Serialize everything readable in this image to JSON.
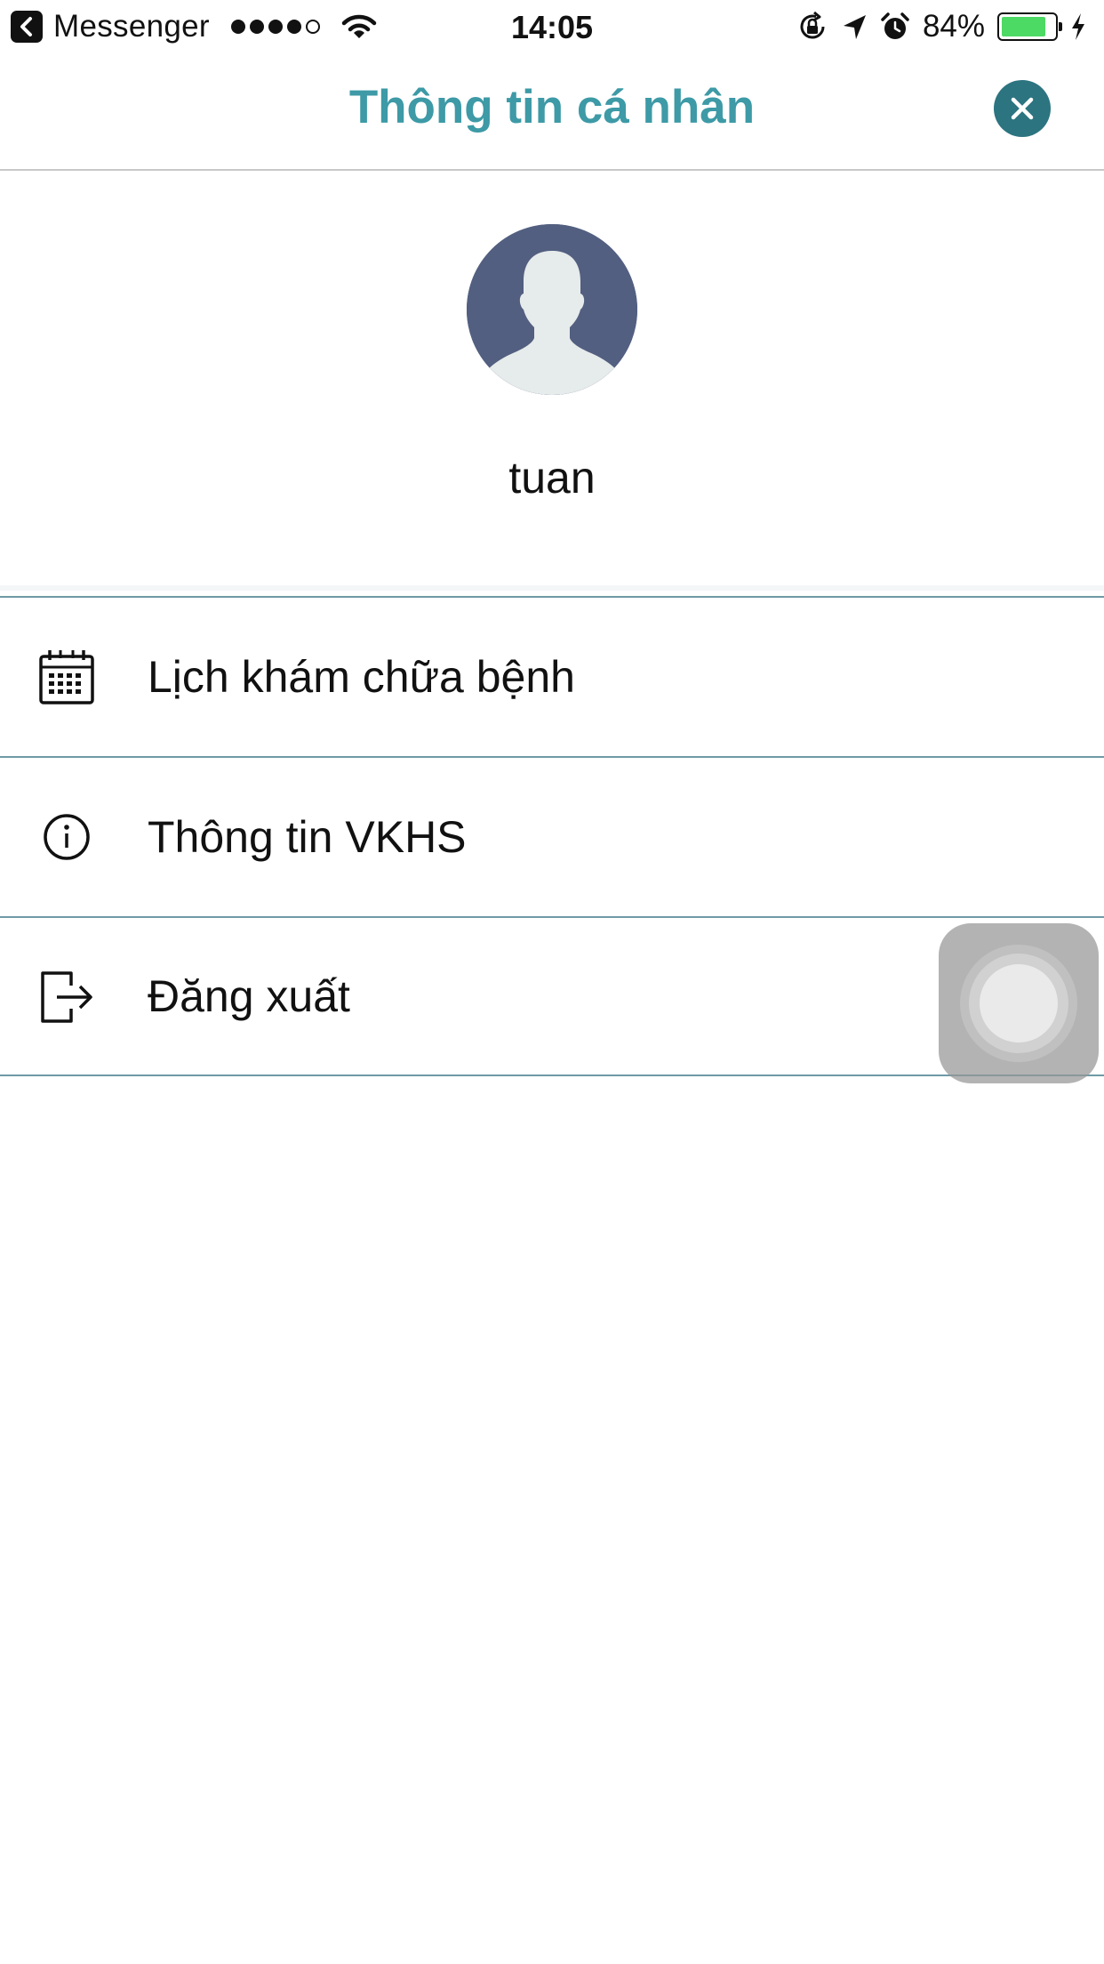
{
  "status_bar": {
    "back_app": "Messenger",
    "signal_strength": 4,
    "signal_max": 5,
    "time": "14:05",
    "battery_percent": "84%",
    "battery_level": 0.84,
    "battery_color": "#4cd964",
    "icons": [
      "back-arrow-icon",
      "signal-dots-icon",
      "wifi-icon",
      "rotation-lock-icon",
      "location-arrow-icon",
      "alarm-icon",
      "battery-icon",
      "charging-bolt-icon"
    ]
  },
  "header": {
    "title": "Thông tin cá nhân",
    "close_icon": "close-icon",
    "title_color": "#3d9aa6",
    "close_color": "#2c7480"
  },
  "profile": {
    "avatar_icon": "default-avatar-icon",
    "username": "tuan"
  },
  "menu": {
    "items": [
      {
        "icon": "calendar-icon",
        "label": "Lịch khám chữa bệnh"
      },
      {
        "icon": "info-icon",
        "label": "Thông tin VKHS"
      },
      {
        "icon": "logout-icon",
        "label": "Đăng xuất"
      }
    ],
    "divider_color": "#6f9aa6"
  },
  "assistive_touch": {
    "icon": "assistive-touch-icon"
  }
}
